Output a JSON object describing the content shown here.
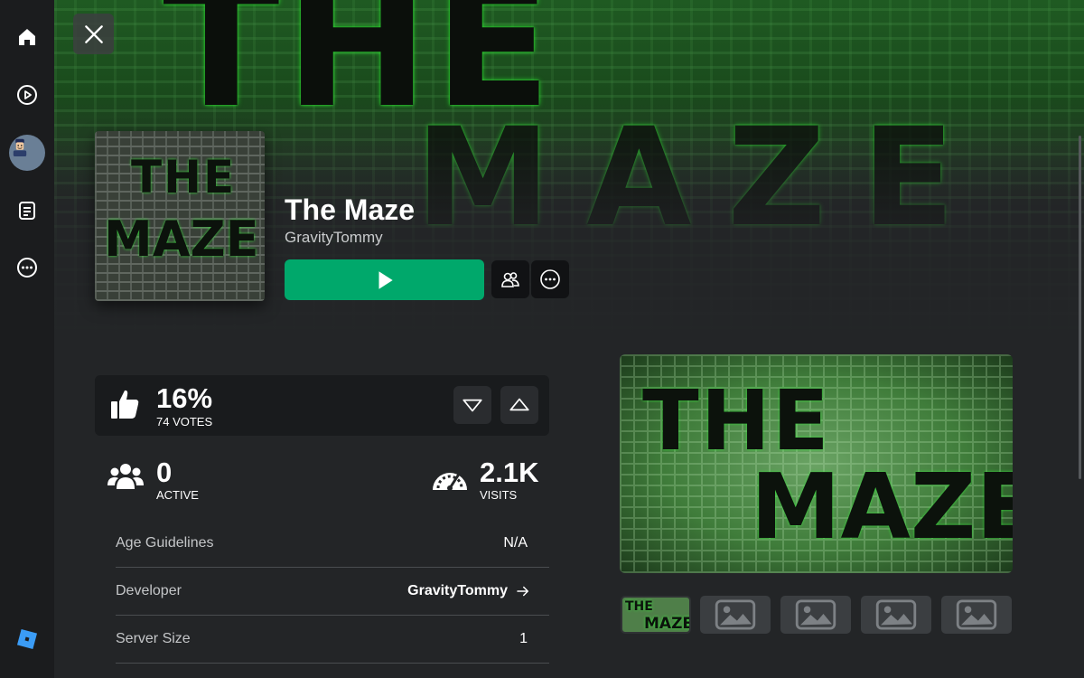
{
  "nav": {
    "items": [
      "home-icon",
      "play-circle-icon",
      "avatar",
      "feed-icon",
      "more-icon"
    ],
    "logo": "roblox-logo"
  },
  "hero": {
    "text_top": "THE",
    "text_bottom": "MAZE"
  },
  "game": {
    "title": "The Maze",
    "creator": "GravityTommy",
    "icon_text_top": "THE",
    "icon_text_bottom": "MAZE"
  },
  "votes": {
    "percent": "16%",
    "count_label": "74 VOTES"
  },
  "stats": {
    "active_value": "0",
    "active_label": "ACTIVE",
    "visits_value": "2.1K",
    "visits_label": "VISITS"
  },
  "info": {
    "age_label": "Age Guidelines",
    "age_value": "N/A",
    "developer_label": "Developer",
    "developer_value": "GravityTommy",
    "server_label": "Server Size",
    "server_value": "1"
  },
  "media": {
    "main_text_top": "THE",
    "main_text_bottom": "MAZE",
    "thumb_text_top": "THE",
    "thumb_text_bottom": "MAZE"
  },
  "colors": {
    "play": "#00a86b",
    "background": "#232527",
    "nav": "#1b1c1e",
    "accent_green": "#2bd42f"
  }
}
